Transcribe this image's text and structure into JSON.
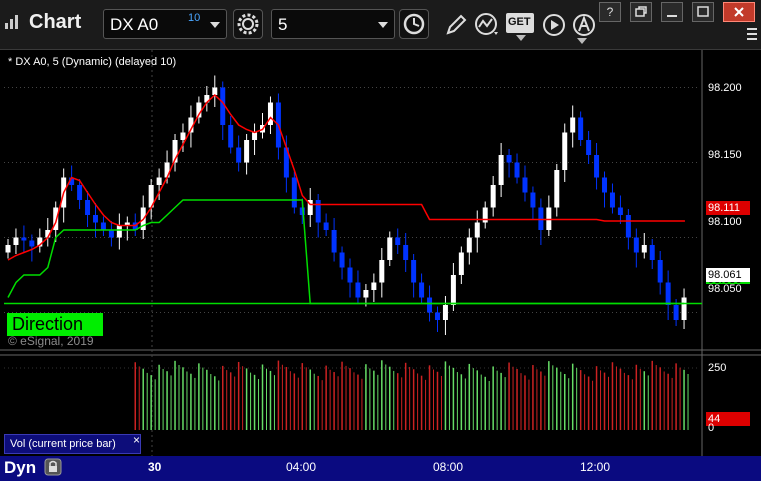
{
  "window": {
    "title": "Chart",
    "symbol": "DX A0",
    "symbol_count": "10",
    "interval": "5",
    "get_label": "GET",
    "help_label": "?"
  },
  "chart": {
    "study_label": "* DX A0, 5 (Dynamic) (delayed 10)",
    "direction_label": "Direction",
    "copyright": "© eSignal, 2019",
    "price_axis": [
      "98.200",
      "98.150",
      "98.100",
      "98.050"
    ],
    "price_label_red": "98.111",
    "price_label_white": "98.061",
    "price_label_green": "98.056",
    "colors": {
      "up_candle": "#ffffff",
      "down_candle": "#0033ff",
      "red_line": "#ff0000",
      "green_line": "#00dd00",
      "background": "#000000",
      "time_bar": "#0a0a80"
    }
  },
  "volume": {
    "panel_label": "Vol (current price bar)",
    "close_label": "×",
    "axis": [
      "250",
      "0"
    ],
    "current_label": "44"
  },
  "time_axis": {
    "labels": [
      "30",
      "04:00",
      "08:00",
      "12:00"
    ],
    "dyn_label": "Dyn"
  },
  "chart_data": {
    "type": "candlestick",
    "title": "DX A0, 5 (Dynamic) (delayed 10)",
    "ylim": [
      98.025,
      98.225
    ],
    "x_labels": [
      "30",
      "04:00",
      "08:00",
      "12:00"
    ],
    "y_ticks": [
      98.2,
      98.15,
      98.1,
      98.05
    ],
    "last_price": 98.061,
    "red_line_last": 98.111,
    "green_line_last": 98.056,
    "close_series": [
      98.095,
      98.1,
      98.098,
      98.094,
      98.1,
      98.105,
      98.12,
      98.14,
      98.135,
      98.125,
      98.115,
      98.11,
      98.105,
      98.1,
      98.108,
      98.11,
      98.105,
      98.12,
      98.135,
      98.14,
      98.15,
      98.165,
      98.17,
      98.18,
      98.19,
      98.195,
      98.2,
      98.175,
      98.16,
      98.15,
      98.165,
      98.17,
      98.175,
      98.19,
      98.16,
      98.14,
      98.12,
      98.115,
      98.125,
      98.11,
      98.105,
      98.09,
      98.08,
      98.07,
      98.06,
      98.065,
      98.07,
      98.085,
      98.1,
      98.095,
      98.085,
      98.07,
      98.06,
      98.05,
      98.045,
      98.055,
      98.075,
      98.09,
      98.1,
      98.11,
      98.12,
      98.135,
      98.155,
      98.15,
      98.14,
      98.13,
      98.12,
      98.105,
      98.12,
      98.145,
      98.17,
      98.18,
      98.165,
      98.155,
      98.14,
      98.13,
      98.12,
      98.115,
      98.1,
      98.09,
      98.095,
      98.085,
      98.07,
      98.055,
      98.045,
      98.06
    ],
    "red_line": [
      98.085,
      98.088,
      98.09,
      98.092,
      98.095,
      98.1,
      98.11,
      98.13,
      98.14,
      98.138,
      98.13,
      98.122,
      98.115,
      98.11,
      98.108,
      98.108,
      98.108,
      98.112,
      98.12,
      98.13,
      98.14,
      98.152,
      98.162,
      98.172,
      98.182,
      98.19,
      98.195,
      98.19,
      98.182,
      98.175,
      98.172,
      98.17,
      98.172,
      98.18,
      98.175,
      98.16,
      98.145,
      98.128,
      98.122,
      98.122,
      98.122,
      98.122,
      98.122,
      98.122,
      98.122,
      98.122,
      98.122,
      98.122,
      98.122,
      98.122,
      98.122,
      98.122,
      98.122,
      98.112,
      98.112,
      98.112,
      98.112,
      98.112,
      98.112,
      98.112,
      98.112,
      98.112,
      98.112,
      98.112,
      98.112,
      98.112,
      98.112,
      98.112,
      98.112,
      98.112,
      98.112,
      98.112,
      98.112,
      98.112,
      98.112,
      98.111,
      98.111,
      98.111,
      98.111,
      98.111,
      98.111,
      98.111,
      98.111,
      98.111,
      98.111,
      98.111
    ],
    "green_line": [
      98.06,
      98.07,
      98.075,
      98.075,
      98.075,
      98.08,
      98.1,
      98.105,
      98.105,
      98.105,
      98.105,
      98.105,
      98.105,
      98.105,
      98.105,
      98.105,
      98.105,
      98.108,
      98.11,
      98.11,
      98.115,
      98.12,
      98.125,
      98.125,
      98.125,
      98.125,
      98.125,
      98.125,
      98.125,
      98.125,
      98.125,
      98.125,
      98.125,
      98.125,
      98.125,
      98.125,
      98.125,
      98.125,
      98.056,
      98.056,
      98.056,
      98.056,
      98.056,
      98.056,
      98.056,
      98.056,
      98.056,
      98.056,
      98.056,
      98.056,
      98.056,
      98.056,
      98.056,
      98.056,
      98.056,
      98.056,
      98.056,
      98.056,
      98.056,
      98.056,
      98.056,
      98.056,
      98.056,
      98.056,
      98.056,
      98.056,
      98.056,
      98.056,
      98.056,
      98.056,
      98.056,
      98.056,
      98.056,
      98.056,
      98.056,
      98.056,
      98.056,
      98.056,
      98.056,
      98.056,
      98.056,
      98.056,
      98.056,
      98.056,
      98.056,
      98.056
    ],
    "volume_ylim": [
      0,
      250
    ],
    "volume_current": 44
  }
}
